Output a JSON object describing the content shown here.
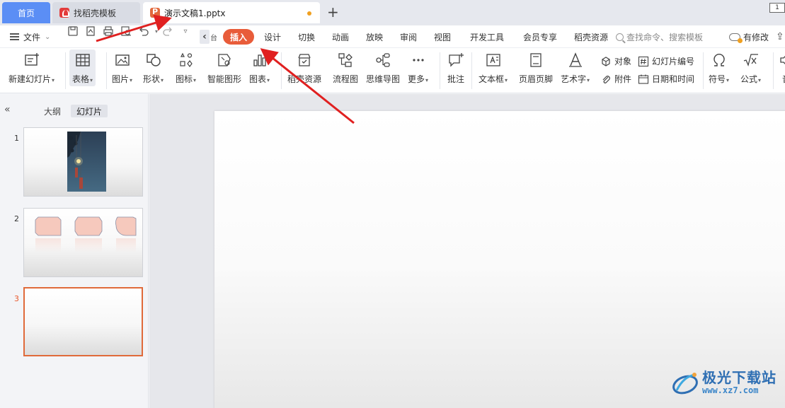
{
  "tabs": {
    "home": "首页",
    "templates": "找稻壳模板",
    "document": "演示文稿1.pptx",
    "add": "+",
    "window_btn": "1"
  },
  "menubar": {
    "file": "文件",
    "prev": "‹",
    "partial": "台",
    "items": [
      "插入",
      "设计",
      "切换",
      "动画",
      "放映",
      "审阅",
      "视图",
      "开发工具",
      "会员专享",
      "稻壳资源"
    ],
    "active_index": 0,
    "search_placeholder": "查找命令、搜索模板",
    "changes": "有修改"
  },
  "ribbon": {
    "new_slide": "新建幻灯片",
    "table": "表格",
    "picture": "图片",
    "shape": "形状",
    "icon": "图标",
    "smartart": "智能图形",
    "chart": "图表",
    "daoke_res": "稻壳资源",
    "flowchart": "流程图",
    "mindmap": "思维导图",
    "more": "更多",
    "comment": "批注",
    "textbox": "文本框",
    "header_footer": "页眉页脚",
    "wordart": "艺术字",
    "object": "对象",
    "attachment": "附件",
    "slide_number": "幻灯片编号",
    "datetime": "日期和时间",
    "symbol": "符号",
    "formula": "公式",
    "audio_partial": "音"
  },
  "panel": {
    "outline": "大纲",
    "slides": "幻灯片",
    "collapse": "«",
    "slide_numbers": [
      "1",
      "2",
      "3"
    ],
    "current_slide": 3
  },
  "watermark": {
    "title": "极光下载站",
    "url": "www.xz7.com"
  },
  "colors": {
    "accent": "#e85c3a",
    "home_tab": "#5b8ef5",
    "annotation_arrow": "#e02020"
  }
}
